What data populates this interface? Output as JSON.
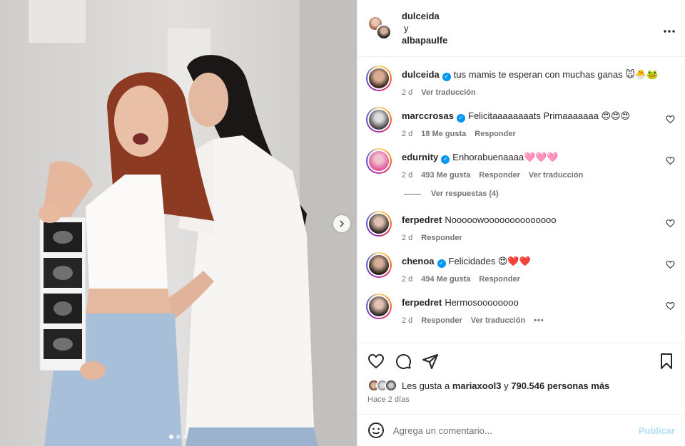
{
  "header": {
    "user1": "dulceida",
    "conjunction": "y",
    "user2": "albapaulfe"
  },
  "caption": {
    "user": "dulceida",
    "text": "tus mamis te esperan con muchas ganas 🐭🐣🐸",
    "time": "2 d",
    "translate": "Ver traducción"
  },
  "comments": [
    {
      "user": "marccrosas",
      "verified": true,
      "text": "Felicitaaaaaaaats Primaaaaaaa 😍😍😍",
      "time": "2 d",
      "likes": "18 Me gusta",
      "reply": "Responder",
      "translate": ""
    },
    {
      "user": "edurnity",
      "verified": true,
      "text": "Enhorabuenaaaa🩷🩷🩷",
      "time": "2 d",
      "likes": "493 Me gusta",
      "reply": "Responder",
      "translate": "Ver traducción"
    },
    {
      "user": "ferpedret",
      "verified": false,
      "text": "Nooooowoooooooooooooo",
      "time": "2 d",
      "likes": "",
      "reply": "Responder",
      "translate": ""
    },
    {
      "user": "chenoa",
      "verified": true,
      "text": "Felicidades 😍❤️❤️",
      "time": "2 d",
      "likes": "494 Me gusta",
      "reply": "Responder",
      "translate": ""
    },
    {
      "user": "ferpedret",
      "verified": false,
      "text": "Hermosoooooooo",
      "time": "2 d",
      "likes": "",
      "reply": "Responder",
      "translate": "Ver traducción",
      "more": "•••"
    }
  ],
  "replies_label": "Ver respuestas (4)",
  "likes": {
    "prefix": "Les gusta a",
    "user": "mariaxool3",
    "conj": "y",
    "count": "790.546 personas más"
  },
  "posted": "Hace 2 días",
  "add_comment": {
    "placeholder": "Agrega un comentario...",
    "publish": "Publicar"
  },
  "carousel": {
    "slides": 3,
    "active": 1
  },
  "colors": {
    "verified": "#0095f6",
    "publish_disabled": "#b2dffc",
    "meta": "#737373"
  },
  "icons": [
    "more-icon",
    "heart-icon",
    "comment-icon",
    "share-icon",
    "bookmark-icon",
    "emoji-icon",
    "chevron-right-icon",
    "verified-icon"
  ]
}
